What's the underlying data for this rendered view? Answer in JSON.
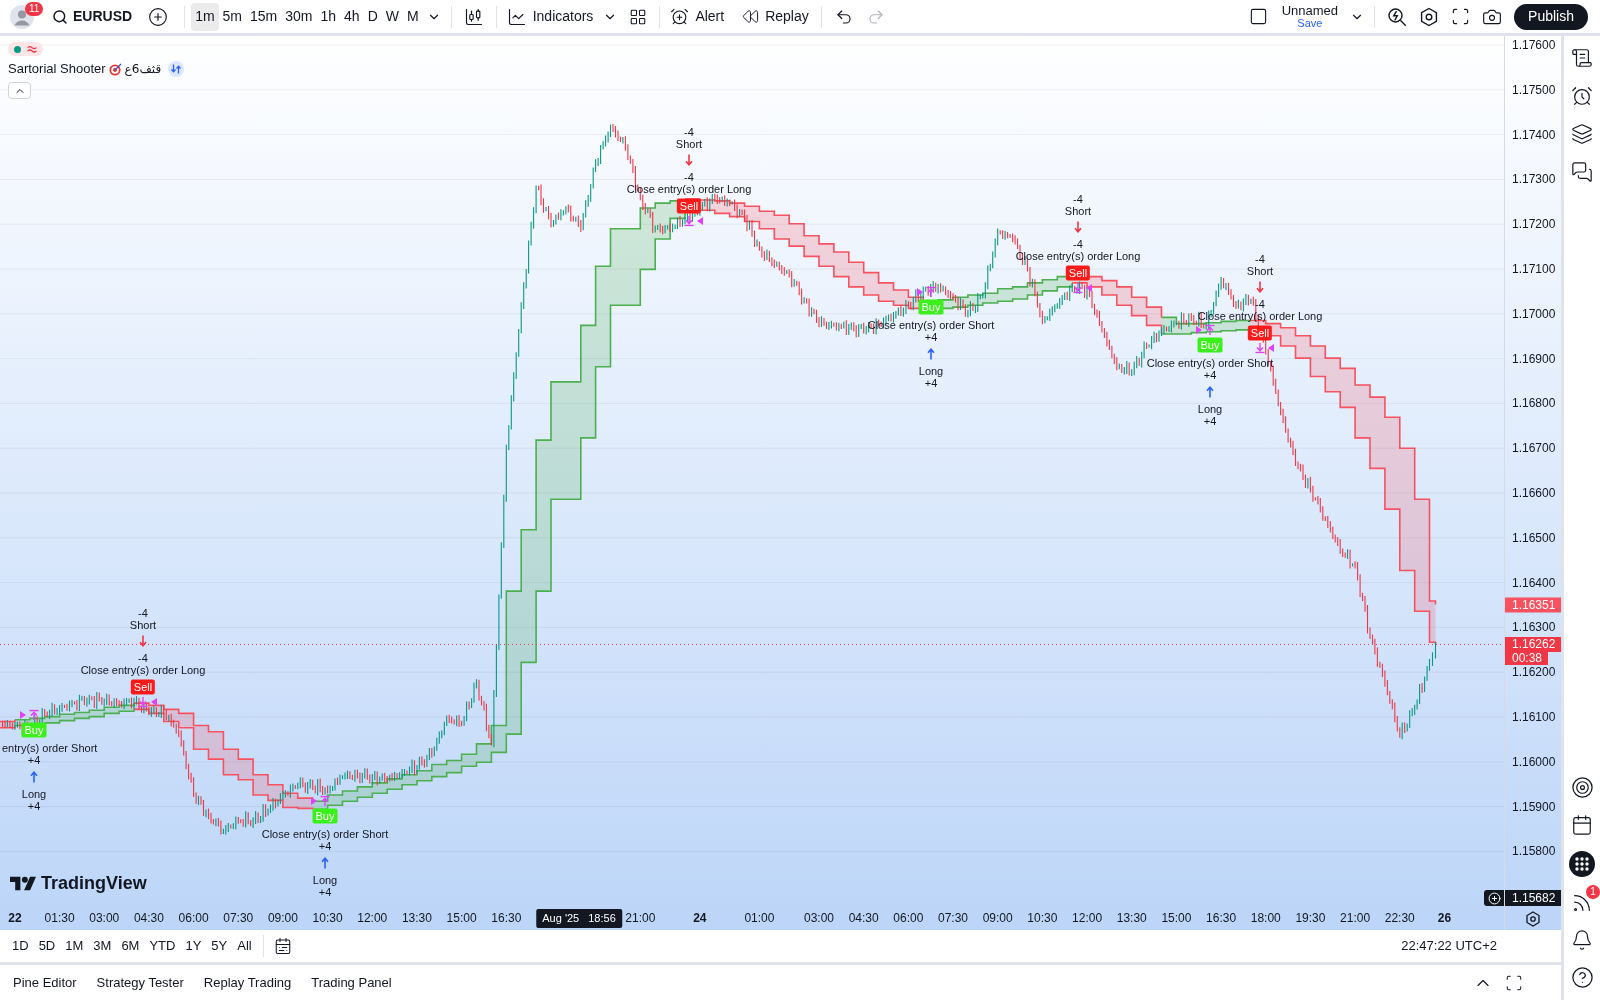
{
  "toolbar": {
    "notification_badge": "11",
    "symbol": "EURUSD",
    "intervals": [
      {
        "label": "1m",
        "selected": true
      },
      {
        "label": "5m",
        "selected": false
      },
      {
        "label": "15m",
        "selected": false
      },
      {
        "label": "30m",
        "selected": false
      },
      {
        "label": "1h",
        "selected": false
      },
      {
        "label": "4h",
        "selected": false
      },
      {
        "label": "D",
        "selected": false
      },
      {
        "label": "W",
        "selected": false
      },
      {
        "label": "M",
        "selected": false
      }
    ],
    "indicators_label": "Indicators",
    "alert_label": "Alert",
    "replay_label": "Replay",
    "history_buttons": [
      {
        "kind": "undo",
        "disabled": false
      },
      {
        "kind": "redo",
        "disabled": true
      }
    ],
    "layout_name": "Unnamed",
    "save_label": "Save",
    "publish_label": "Publish"
  },
  "legend": {
    "indicator_name": "Sartorial Shooter",
    "indicator_suffix": "قثف6ع"
  },
  "chart": {
    "price_axis_labels": [
      "1.17600",
      "1.17500",
      "1.17400",
      "1.17300",
      "1.17200",
      "1.17100",
      "1.17000",
      "1.16900",
      "1.16800",
      "1.16700",
      "1.16600",
      "1.16500",
      "1.16400",
      "1.16300",
      "1.16200",
      "1.16100",
      "1.16000",
      "1.15900",
      "1.15800"
    ],
    "time_axis_labels": [
      {
        "label": "22",
        "kind": "day"
      },
      {
        "label": "01:30",
        "kind": "time"
      },
      {
        "label": "03:00",
        "kind": "time"
      },
      {
        "label": "04:30",
        "kind": "time"
      },
      {
        "label": "06:00",
        "kind": "time"
      },
      {
        "label": "07:30",
        "kind": "time"
      },
      {
        "label": "09:00",
        "kind": "time"
      },
      {
        "label": "10:30",
        "kind": "time"
      },
      {
        "label": "12:00",
        "kind": "time"
      },
      {
        "label": "13:30",
        "kind": "time"
      },
      {
        "label": "15:00",
        "kind": "time"
      },
      {
        "label": "16:30",
        "kind": "time"
      },
      {
        "label": "21:00",
        "kind": "time"
      },
      {
        "label": "24",
        "kind": "day"
      },
      {
        "label": "01:00",
        "kind": "time"
      },
      {
        "label": "03:00",
        "kind": "time"
      },
      {
        "label": "04:30",
        "kind": "time"
      },
      {
        "label": "06:00",
        "kind": "time"
      },
      {
        "label": "07:30",
        "kind": "time"
      },
      {
        "label": "09:00",
        "kind": "time"
      },
      {
        "label": "10:30",
        "kind": "time"
      },
      {
        "label": "12:00",
        "kind": "time"
      },
      {
        "label": "13:30",
        "kind": "time"
      },
      {
        "label": "15:00",
        "kind": "time"
      },
      {
        "label": "16:30",
        "kind": "time"
      },
      {
        "label": "18:00",
        "kind": "time"
      },
      {
        "label": "19:30",
        "kind": "time"
      },
      {
        "label": "21:00",
        "kind": "time"
      },
      {
        "label": "22:30",
        "kind": "time"
      },
      {
        "label": "26",
        "kind": "day"
      }
    ],
    "signals": [
      {
        "kind": "buy",
        "badge": "Buy",
        "close_label": "entry(s) order Short",
        "close_qty": "+4",
        "entry_label": "Long",
        "entry_qty": "+4"
      },
      {
        "kind": "sell",
        "badge": "Sell",
        "entry_qty": "-4",
        "entry_label": "Short",
        "close_qty": "-4",
        "close_label": "Close entry(s) order Long"
      },
      {
        "kind": "buy",
        "badge": "Buy",
        "close_label": "Close entry(s) order Short",
        "close_qty": "+4",
        "entry_label": "Long",
        "entry_qty": "+4"
      },
      {
        "kind": "sell",
        "badge": "Sell",
        "entry_qty": "-4",
        "entry_label": "Short",
        "close_qty": "-4",
        "close_label": "Close entry(s) order Long"
      },
      {
        "kind": "buy",
        "badge": "Buy",
        "close_label": "Close entry(s) order Short",
        "close_qty": "+4",
        "entry_label": "Long",
        "entry_qty": "+4"
      },
      {
        "kind": "sell",
        "badge": "Sell",
        "entry_qty": "-4",
        "entry_label": "Short",
        "close_qty": "-4",
        "close_label": "Close entry(s) order Long"
      },
      {
        "kind": "buy",
        "badge": "Buy",
        "close_label": "Close entry(s) order Short",
        "close_qty": "+4",
        "entry_label": "Long",
        "entry_qty": "+4"
      },
      {
        "kind": "sell",
        "badge": "Sell",
        "entry_qty": "-4",
        "entry_label": "Short",
        "close_qty": "-4",
        "close_label": "Close entry(s) order Long"
      }
    ],
    "price_labels": {
      "indicator": "1.16351",
      "last_price": "1.16262",
      "countdown": "00:38"
    },
    "crosshair": {
      "date": "Aug '25",
      "time": "18:56",
      "price": "1.15682"
    },
    "logo": "TradingView"
  },
  "range_buttons": [
    "1D",
    "5D",
    "1M",
    "3M",
    "6M",
    "YTD",
    "1Y",
    "5Y",
    "All"
  ],
  "clock": "22:47:22 UTC+2",
  "bottom_tabs": [
    "Pine Editor",
    "Strategy Tester",
    "Replay Trading",
    "Trading Panel"
  ],
  "sidebar": {
    "feed_badge": "1"
  }
}
